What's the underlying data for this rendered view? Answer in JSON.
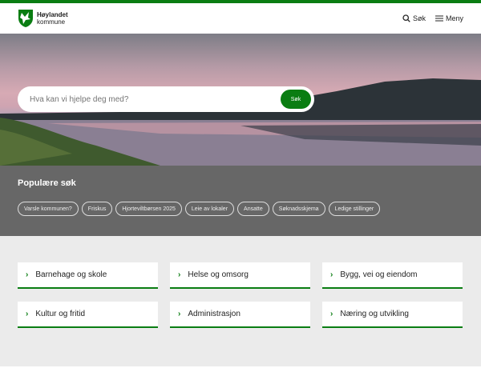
{
  "brand": {
    "name": "Høylandet",
    "sub": "kommune",
    "accent": "#0a7d12"
  },
  "header": {
    "search_label": "Søk",
    "menu_label": "Meny"
  },
  "hero": {
    "search_placeholder": "Hva kan vi hjelpe deg med?",
    "search_button": "Søk"
  },
  "popular": {
    "title": "Populære søk",
    "chips": [
      "Varsle kommunen?",
      "Friskus",
      "Hjorteviltbørsen 2025",
      "Leie av lokaler",
      "Ansatte",
      "Søknadsskjema",
      "Ledige stillinger"
    ]
  },
  "categories": [
    "Barnehage og skole",
    "Helse og omsorg",
    "Bygg, vei og eiendom",
    "Kultur og fritid",
    "Administrasjon",
    "Næring og utvikling"
  ]
}
